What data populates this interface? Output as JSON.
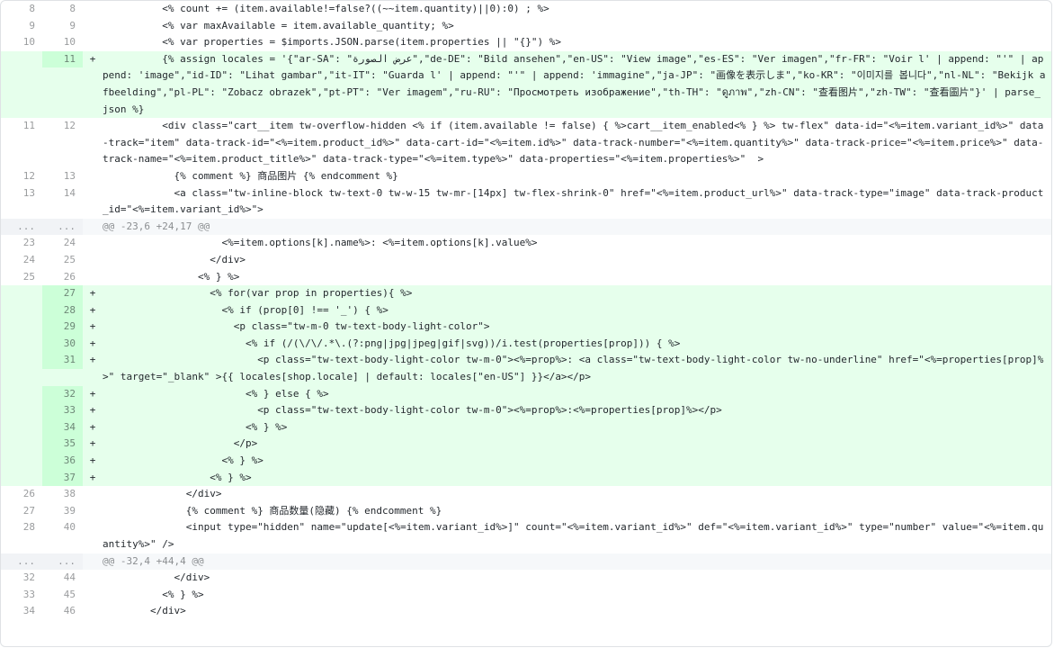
{
  "lines": [
    {
      "type": "ctx",
      "old": "8",
      "new": "8",
      "sign": "",
      "text": "          <% count += (item.available!=false?((~~item.quantity)||0):0) ; %>"
    },
    {
      "type": "ctx",
      "old": "9",
      "new": "9",
      "sign": "",
      "text": "          <% var maxAvailable = item.available_quantity; %>"
    },
    {
      "type": "ctx",
      "old": "10",
      "new": "10",
      "sign": "",
      "text": "          <% var properties = $imports.JSON.parse(item.properties || \"{}\") %>"
    },
    {
      "type": "add",
      "old": "",
      "new": "11",
      "sign": "+",
      "text": "          {% assign locales = '{\"ar-SA\": \"عرض الصورة\",\"de-DE\": \"Bild ansehen\",\"en-US\": \"View image\",\"es-ES\": \"Ver imagen\",\"fr-FR\": \"Voir l' | append: \"'\" | append: 'image\",\"id-ID\": \"Lihat gambar\",\"it-IT\": \"Guarda l' | append: \"'\" | append: 'immagine\",\"ja-JP\": \"画像を表示しま\",\"ko-KR\": \"이미지를 봅니다\",\"nl-NL\": \"Bekijk afbeelding\",\"pl-PL\": \"Zobacz obrazek\",\"pt-PT\": \"Ver imagem\",\"ru-RU\": \"Просмотреть изображение\",\"th-TH\": \"ดูภาพ\",\"zh-CN\": \"查看图片\",\"zh-TW\": \"查看圖片\"}' | parse_json %}"
    },
    {
      "type": "ctx",
      "old": "11",
      "new": "12",
      "sign": "",
      "text": "          <div class=\"cart__item tw-overflow-hidden <% if (item.available != false) { %>cart__item_enabled<% } %> tw-flex\" data-id=\"<%=item.variant_id%>\" data-track=\"item\" data-track-id=\"<%=item.product_id%>\" data-cart-id=\"<%=item.id%>\" data-track-number=\"<%=item.quantity%>\" data-track-price=\"<%=item.price%>\" data-track-name=\"<%=item.product_title%>\" data-track-type=\"<%=item.type%>\" data-properties=\"<%=item.properties%>\"  >"
    },
    {
      "type": "ctx",
      "old": "12",
      "new": "13",
      "sign": "",
      "text": "            {% comment %} 商品图片 {% endcomment %}"
    },
    {
      "type": "ctx",
      "old": "13",
      "new": "14",
      "sign": "",
      "text": "            <a class=\"tw-inline-block tw-text-0 tw-w-15 tw-mr-[14px] tw-flex-shrink-0\" href=\"<%=item.product_url%>\" data-track-type=\"image\" data-track-product_id=\"<%=item.variant_id%>\">"
    },
    {
      "type": "hunk",
      "old": "...",
      "new": "...",
      "sign": "",
      "text": "@@ -23,6 +24,17 @@"
    },
    {
      "type": "ctx",
      "old": "23",
      "new": "24",
      "sign": "",
      "text": "                    <%=item.options[k].name%>: <%=item.options[k].value%>"
    },
    {
      "type": "ctx",
      "old": "24",
      "new": "25",
      "sign": "",
      "text": "                  </div>"
    },
    {
      "type": "ctx",
      "old": "25",
      "new": "26",
      "sign": "",
      "text": "                <% } %>"
    },
    {
      "type": "add",
      "old": "",
      "new": "27",
      "sign": "+",
      "text": "                  <% for(var prop in properties){ %>"
    },
    {
      "type": "add",
      "old": "",
      "new": "28",
      "sign": "+",
      "text": "                    <% if (prop[0] !== '_') { %>"
    },
    {
      "type": "add",
      "old": "",
      "new": "29",
      "sign": "+",
      "text": "                      <p class=\"tw-m-0 tw-text-body-light-color\">"
    },
    {
      "type": "add",
      "old": "",
      "new": "30",
      "sign": "+",
      "text": "                        <% if (/(\\/\\/.*\\.(?:png|jpg|jpeg|gif|svg))/i.test(properties[prop])) { %>"
    },
    {
      "type": "add",
      "old": "",
      "new": "31",
      "sign": "+",
      "text": "                          <p class=\"tw-text-body-light-color tw-m-0\"><%=prop%>: <a class=\"tw-text-body-light-color tw-no-underline\" href=\"<%=properties[prop]%>\" target=\"_blank\" >{{ locales[shop.locale] | default: locales[\"en-US\"] }}</a></p>"
    },
    {
      "type": "add",
      "old": "",
      "new": "32",
      "sign": "+",
      "text": "                        <% } else { %>"
    },
    {
      "type": "add",
      "old": "",
      "new": "33",
      "sign": "+",
      "text": "                          <p class=\"tw-text-body-light-color tw-m-0\"><%=prop%>:<%=properties[prop]%></p>"
    },
    {
      "type": "add",
      "old": "",
      "new": "34",
      "sign": "+",
      "text": "                        <% } %>"
    },
    {
      "type": "add",
      "old": "",
      "new": "35",
      "sign": "+",
      "text": "                      </p>"
    },
    {
      "type": "add",
      "old": "",
      "new": "36",
      "sign": "+",
      "text": "                    <% } %>"
    },
    {
      "type": "add",
      "old": "",
      "new": "37",
      "sign": "+",
      "text": "                  <% } %>"
    },
    {
      "type": "ctx",
      "old": "26",
      "new": "38",
      "sign": "",
      "text": "              </div>"
    },
    {
      "type": "ctx",
      "old": "27",
      "new": "39",
      "sign": "",
      "text": "              {% comment %} 商品数量(隐藏) {% endcomment %}"
    },
    {
      "type": "ctx",
      "old": "28",
      "new": "40",
      "sign": "",
      "text": "              <input type=\"hidden\" name=\"update[<%=item.variant_id%>]\" count=\"<%=item.variant_id%>\" def=\"<%=item.variant_id%>\" type=\"number\" value=\"<%=item.quantity%>\" />"
    },
    {
      "type": "hunk",
      "old": "...",
      "new": "...",
      "sign": "",
      "text": "@@ -32,4 +44,4 @@"
    },
    {
      "type": "ctx",
      "old": "32",
      "new": "44",
      "sign": "",
      "text": "            </div>"
    },
    {
      "type": "ctx",
      "old": "33",
      "new": "45",
      "sign": "",
      "text": "          <% } %>"
    },
    {
      "type": "ctx",
      "old": "34",
      "new": "46",
      "sign": "",
      "text": "        </div>"
    }
  ]
}
